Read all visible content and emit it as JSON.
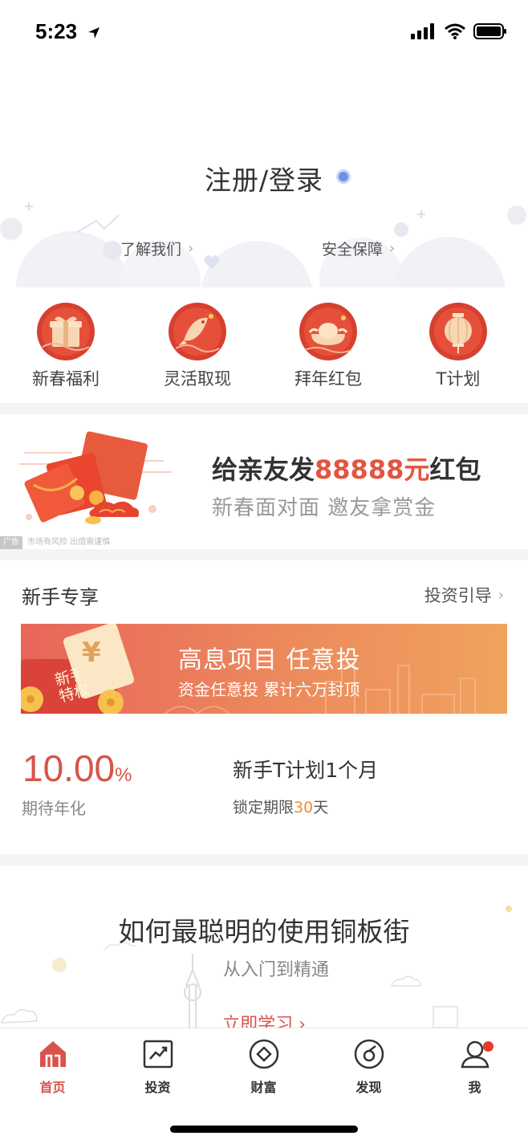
{
  "status_bar": {
    "time": "5:23"
  },
  "header": {
    "login_label": "注册/登录",
    "links": [
      {
        "label": "了解我们"
      },
      {
        "label": "安全保障"
      }
    ]
  },
  "quick_actions": [
    {
      "label": "新春福利",
      "icon": "gift-icon"
    },
    {
      "label": "灵活取现",
      "icon": "koi-fish-icon"
    },
    {
      "label": "拜年红包",
      "icon": "gold-ingot-icon"
    },
    {
      "label": "T计划",
      "icon": "lantern-icon"
    }
  ],
  "ad_banner": {
    "title_prefix": "给亲友发",
    "title_amount": "88888元",
    "title_suffix": "红包",
    "subtitle": "新春面对面 邀友拿赏金",
    "ad_tag": "广告",
    "ad_note": "市场有风险 出借需谨慎"
  },
  "newbie": {
    "section_title": "新手专享",
    "guide_link": "投资引导",
    "banner": {
      "title": "高息项目 任意投",
      "subtitle": "资金任意投 累计六万封顶",
      "coupon_currency": "¥",
      "coupon_text": "新手特权"
    },
    "rate_value": "10.00",
    "rate_unit": "%",
    "rate_label": "期待年化",
    "product_name": "新手T计划1个月",
    "term_prefix": "锁定期限",
    "term_days": "30",
    "term_suffix": "天"
  },
  "learn": {
    "title": "如何最聪明的使用铜板街",
    "subtitle": "从入门到精通",
    "button": "立即学习"
  },
  "tabbar": [
    {
      "label": "首页",
      "icon": "home-icon",
      "active": true
    },
    {
      "label": "投资",
      "icon": "chart-icon",
      "active": false
    },
    {
      "label": "财富",
      "icon": "diamond-icon",
      "active": false
    },
    {
      "label": "发现",
      "icon": "discover-icon",
      "active": false
    },
    {
      "label": "我",
      "icon": "user-icon",
      "active": false,
      "badge": true
    }
  ],
  "colors": {
    "accent_red": "#d9534a",
    "highlight_red": "#e4543f",
    "orange": "#f08b2e",
    "login_dot": "#6f8fe6"
  }
}
